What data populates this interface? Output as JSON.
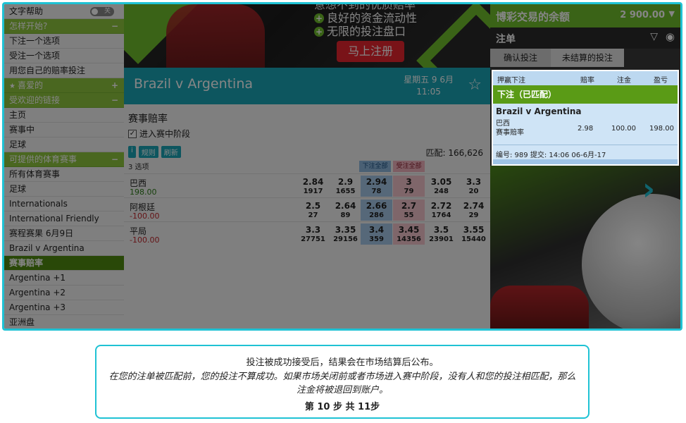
{
  "sidebar": {
    "help": {
      "label": "文字帮助",
      "toggle": "关"
    },
    "getting_started": {
      "label": "怎样开始?",
      "sign": "−"
    },
    "start_items": [
      "下注一个选项",
      "受注一个选项",
      "用您自己的赔率投注"
    ],
    "favourites": {
      "label": "喜爱的",
      "sign": "+"
    },
    "popular": {
      "label": "受欢迎的链接",
      "sign": "−"
    },
    "popular_items": [
      "主页",
      "赛事中",
      "足球"
    ],
    "sports": {
      "label": "可提供的体育赛事",
      "sign": "−"
    },
    "sports_items": [
      "所有体育赛事",
      "足球",
      "Internationals",
      "International Friendly",
      "赛程赛果 6月9日",
      "Brazil v Argentina"
    ],
    "active_item": "赛事赔率",
    "after_items": [
      "Argentina +1",
      "Argentina +2",
      "Argentina +3",
      "亚洲盘"
    ]
  },
  "banner": {
    "lines": [
      "意想不到的优质赔率",
      "良好的资金流动性",
      "无限的投注盘口"
    ],
    "button": "马上注册"
  },
  "event": {
    "title": "Brazil v Argentina",
    "date": "星期五 9 6月",
    "time": "11:05"
  },
  "market": {
    "title": "赛事赔率",
    "inplay": "进入赛中阶段",
    "rules_prefix": "i",
    "rules": "规则",
    "refresh": "刷新",
    "matched": "匹配: 166,626",
    "selections": "3 选项",
    "back_all": "下注全部",
    "lay_all": "受注全部",
    "runners": [
      {
        "name": "巴西",
        "pl": "198.00",
        "pl_color": "#2e7d1a",
        "prices": [
          [
            "2.84",
            "1917"
          ],
          [
            "2.9",
            "1655"
          ],
          [
            "2.94",
            "78"
          ],
          [
            "3",
            "79"
          ],
          [
            "3.05",
            "248"
          ],
          [
            "3.3",
            "20"
          ]
        ]
      },
      {
        "name": "阿根廷",
        "pl": "-100.00",
        "pl_color": "#c0282d",
        "prices": [
          [
            "2.5",
            "27"
          ],
          [
            "2.64",
            "89"
          ],
          [
            "2.66",
            "286"
          ],
          [
            "2.7",
            "55"
          ],
          [
            "2.72",
            "1764"
          ],
          [
            "2.74",
            "29"
          ]
        ]
      },
      {
        "name": "平局",
        "pl": "-100.00",
        "pl_color": "#c0282d",
        "prices": [
          [
            "3.3",
            "27751"
          ],
          [
            "3.35",
            "29156"
          ],
          [
            "3.4",
            "359"
          ],
          [
            "3.45",
            "14356"
          ],
          [
            "3.5",
            "23901"
          ],
          [
            "3.55",
            "15440"
          ]
        ]
      }
    ]
  },
  "betslip": {
    "balance_label": "博彩交易的余额",
    "balance_value": "2 900.00",
    "title": "注单",
    "tab_confirm": "确认投注",
    "tab_unsettled": "未结算的投注",
    "headers": [
      "押赢下注",
      "赔率",
      "注金",
      "盈亏"
    ],
    "status": "下注（已匹配）",
    "event": "Brazil v Argentina",
    "selection": "巴西",
    "market": "赛事赔率",
    "odds": "2.98",
    "stake": "100.00",
    "profit": "198.00",
    "ref": "编号: 989 提交: 14:06 06-6月-17"
  },
  "tooltip": {
    "line1": "投注被成功接受后，结果会在市场结算后公布。",
    "line2": "在您的注单被匹配前，您的投注不算成功。如果市场关闭前或者市场进入赛中阶段，没有人和您的投注相匹配，那么注金将被退回到账户。",
    "step": "第 10 步 共 11步"
  },
  "colors": {
    "accent": "#1fc2d4",
    "green": "#6fbf2c",
    "back": "#a6c8e8",
    "lay": "#f4c3cc"
  }
}
